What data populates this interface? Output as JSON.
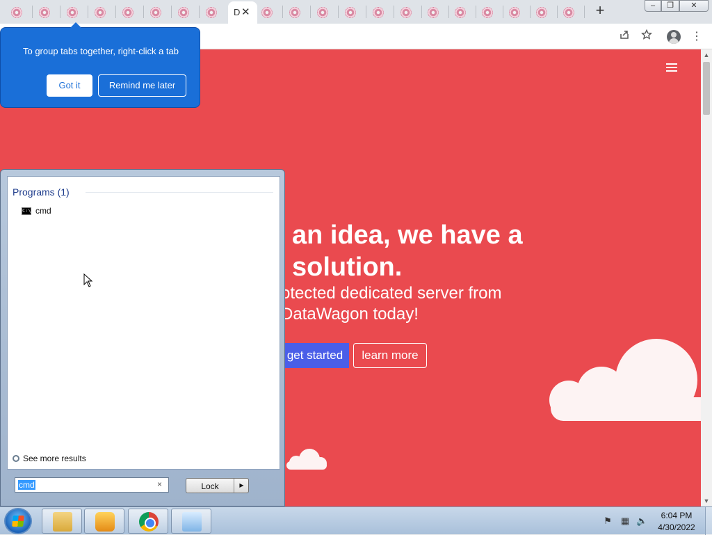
{
  "browser": {
    "active_tab_title": "D",
    "active_tab_close": "✕",
    "new_tab_label": "+",
    "window_min": "‒",
    "window_max": "❐",
    "window_close": "✕"
  },
  "toolbar": {
    "share_icon": "share-icon",
    "bookmark_icon": "star-icon",
    "menu_icon": "⋮"
  },
  "tab_group_hint": {
    "text": "To group tabs together, right-click a tab",
    "got_it": "Got it",
    "remind": "Remind me later"
  },
  "page": {
    "hero_title": "an idea, we have a solution.",
    "hero_subtitle": "otected dedicated server from DataWagon today!",
    "cta_primary": "get started",
    "cta_secondary": "learn more",
    "accent": "#ea4a4f",
    "button_color": "#4a5ee8"
  },
  "start_menu": {
    "heading": "Programs (1)",
    "results": [
      {
        "label": "cmd",
        "icon": "cmd-icon"
      }
    ],
    "see_more": "See more results",
    "search_value": "cmd",
    "clear_label": "×",
    "lock_label": "Lock",
    "lock_arrow": "▶"
  },
  "taskbar": {
    "pinned": [
      "explorer-icon",
      "media-player-icon",
      "chrome-icon",
      "remote-desktop-icon"
    ],
    "time": "6:04 PM",
    "date": "4/30/2022"
  }
}
